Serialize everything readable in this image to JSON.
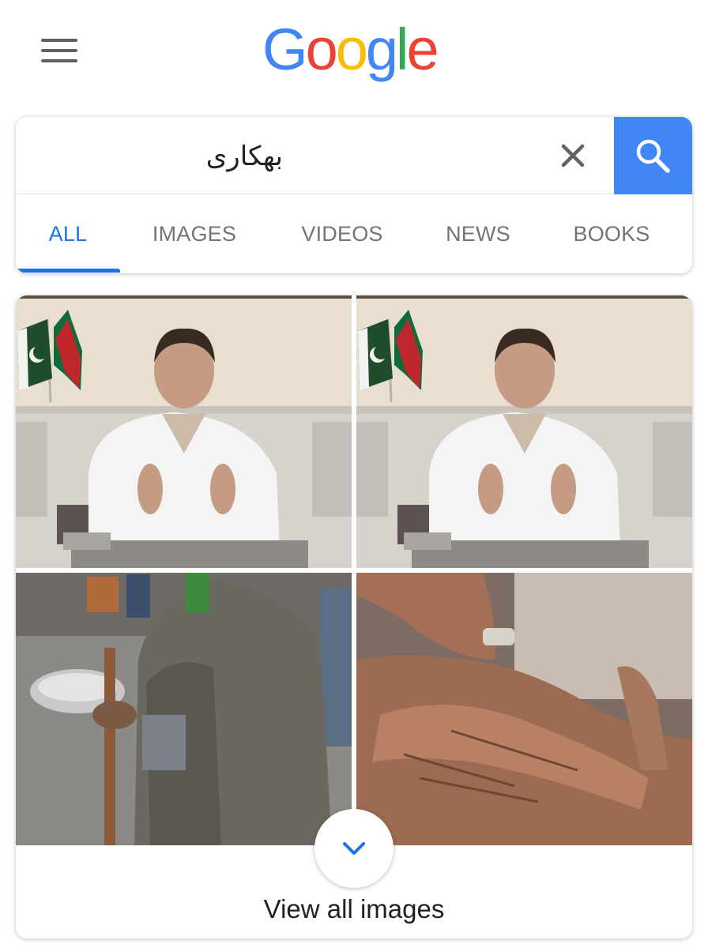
{
  "header": {
    "logo_text": "Google",
    "logo_colors": [
      "#4285f4",
      "#ea4335",
      "#fbbc05",
      "#4285f4",
      "#34a853",
      "#ea4335"
    ]
  },
  "search": {
    "query": "بھکاری",
    "accent_color": "#4285f4"
  },
  "tabs": [
    {
      "label": "ALL",
      "active": true
    },
    {
      "label": "IMAGES",
      "active": false
    },
    {
      "label": "VIDEOS",
      "active": false
    },
    {
      "label": "NEWS",
      "active": false
    },
    {
      "label": "BOOKS",
      "active": false
    }
  ],
  "images": {
    "thumbnails": [
      {
        "icon": "speech-photo"
      },
      {
        "icon": "speech-photo"
      },
      {
        "icon": "beggar-photo"
      },
      {
        "icon": "hands-photo"
      }
    ],
    "view_all_label": "View all images"
  }
}
